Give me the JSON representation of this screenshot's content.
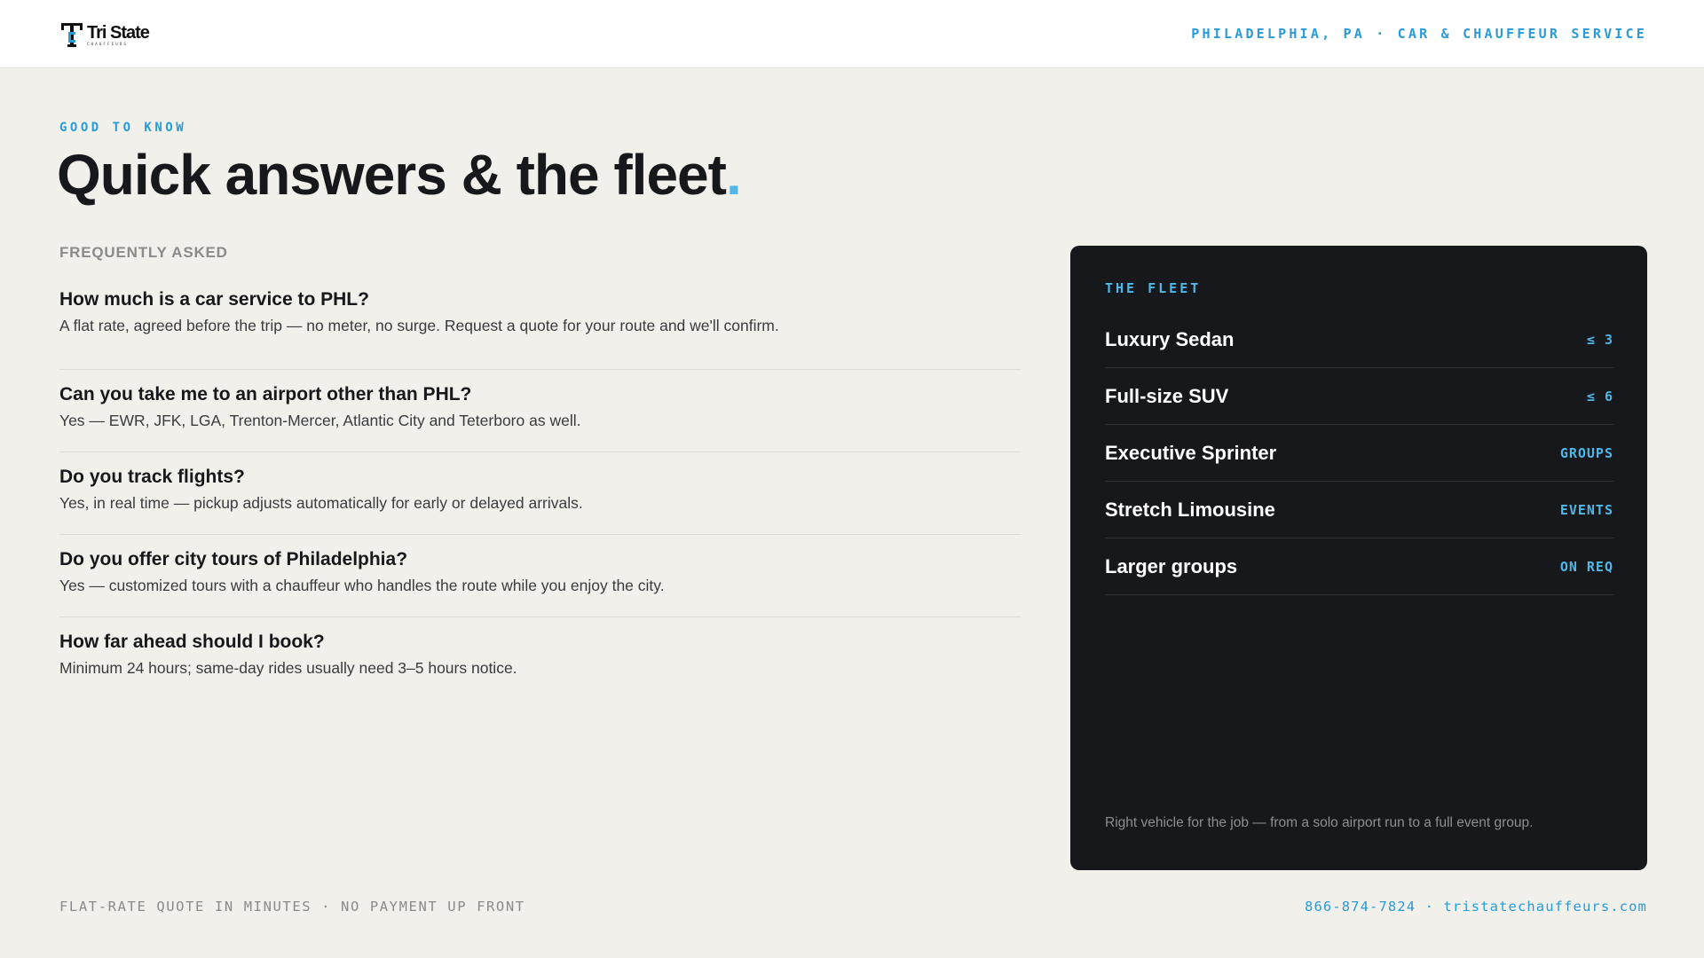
{
  "header": {
    "logo_name": "Tri State",
    "logo_sub": "CHAUFFEURS",
    "tagline": "PHILADELPHIA, PA · CAR & CHAUFFEUR SERVICE"
  },
  "hero": {
    "eyebrow": "GOOD TO KNOW",
    "title": "Quick answers & the fleet",
    "title_dot": "."
  },
  "faq": {
    "label": "FREQUENTLY ASKED",
    "items": [
      {
        "q": "How much is a car service to PHL?",
        "a": "A flat rate, agreed before the trip — no meter, no surge. Request a quote for your route and we'll confirm."
      },
      {
        "q": "Can you take me to an airport other than PHL?",
        "a": "Yes — EWR, JFK, LGA, Trenton-Mercer, Atlantic City and Teterboro as well."
      },
      {
        "q": "Do you track flights?",
        "a": "Yes, in real time — pickup adjusts automatically for early or delayed arrivals."
      },
      {
        "q": "Do you offer city tours of Philadelphia?",
        "a": "Yes — customized tours with a chauffeur who handles the route while you enjoy the city."
      },
      {
        "q": "How far ahead should I book?",
        "a": "Minimum 24 hours; same-day rides usually need 3–5 hours notice."
      }
    ]
  },
  "fleet": {
    "label": "THE FLEET",
    "vehicles": [
      {
        "name": "Luxury Sedan",
        "capacity": "≤ 3"
      },
      {
        "name": "Full-size SUV",
        "capacity": "≤ 6"
      },
      {
        "name": "Executive Sprinter",
        "capacity": "GROUPS"
      },
      {
        "name": "Stretch Limousine",
        "capacity": "EVENTS"
      },
      {
        "name": "Larger groups",
        "capacity": "ON REQ"
      }
    ],
    "note": "Right vehicle for the job — from a solo airport run to a full event group."
  },
  "footer": {
    "left": "FLAT-RATE QUOTE IN MINUTES · NO PAYMENT UP FRONT",
    "right": "866-874-7824 · tristatechauffeurs.com"
  },
  "colors": {
    "accent": "#2a9bd6",
    "accent_light": "#4fb8e8",
    "background": "#f2f0ea",
    "panel": "#17181c"
  }
}
